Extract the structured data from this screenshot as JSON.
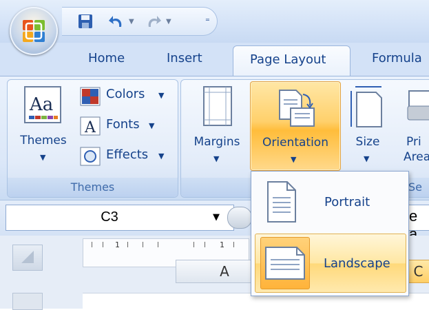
{
  "tabs": [
    "Home",
    "Insert",
    "Page Layout",
    "Formula"
  ],
  "themes_group": {
    "themes_label": "Themes",
    "colors_label": "Colors",
    "fonts_label": "Fonts",
    "effects_label": "Effects",
    "group_label": "Themes"
  },
  "page_setup_group": {
    "margins_label": "Margins",
    "orientation_label": "Orientation",
    "size_label": "Size",
    "print_area_label_line1": "Pri",
    "print_area_label_line2": "Area",
    "group_label_partial": "Se"
  },
  "orientation_menu": {
    "items": [
      {
        "label": "Portrait"
      },
      {
        "label": "Landscape"
      }
    ],
    "highlighted": "Landscape"
  },
  "formula_bar": {
    "name_box_value": "C3",
    "formula_text_partial": "e a"
  },
  "sheet": {
    "column_a": "A",
    "column_c": "C",
    "ruler_mark": "1"
  }
}
